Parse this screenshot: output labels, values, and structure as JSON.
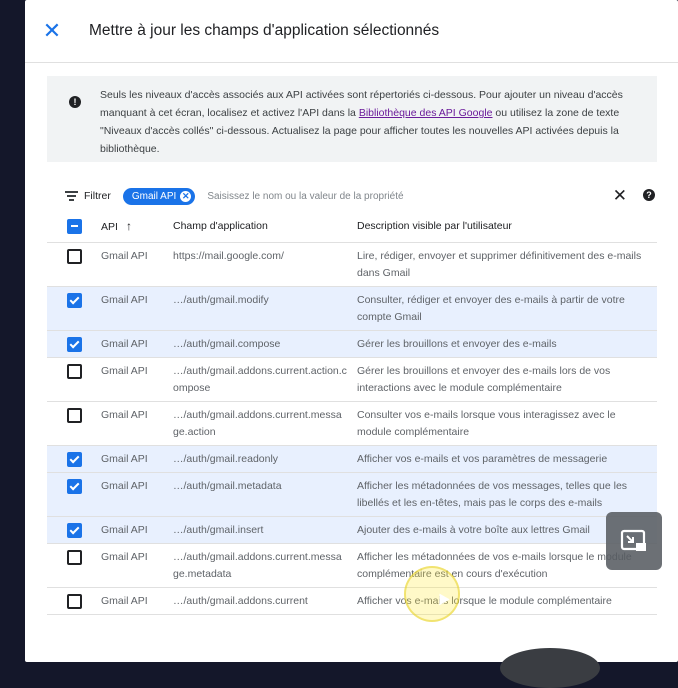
{
  "dialog": {
    "title": "Mettre à jour les champs d'application sélectionnés",
    "close_symbol": "✕"
  },
  "info": {
    "icon": "!",
    "text_before": "Seuls les niveaux d'accès associés aux API activées sont répertoriés ci-dessous. Pour ajouter un niveau d'accès manquant à cet écran, localisez et activez l'API dans la ",
    "link": "Bibliothèque des API Google",
    "text_after": " ou utilisez la zone de texte \"Niveaux d'accès collés\" ci-dessous. Actualisez la page pour afficher toutes les nouvelles API activées depuis la bibliothèque."
  },
  "filter": {
    "label": "Filtrer",
    "chip": "Gmail API",
    "chip_close": "✕",
    "placeholder": "Saisissez le nom ou la valeur de la propriété",
    "clear_symbol": "✕",
    "help_symbol": "?"
  },
  "table": {
    "columns": {
      "api": "API",
      "sort_arrow": "↑",
      "scope": "Champ d'application",
      "description": "Description visible par l'utilisateur"
    },
    "header_checkbox": "partial",
    "rows": [
      {
        "checked": false,
        "api": "Gmail API",
        "scope": "https://mail.google.com/",
        "description": "Lire, rédiger, envoyer et supprimer définitivement des e-mails dans Gmail"
      },
      {
        "checked": true,
        "api": "Gmail API",
        "scope": "…/auth/gmail.modify",
        "description": "Consulter, rédiger et envoyer des e-mails à partir de votre compte Gmail"
      },
      {
        "checked": true,
        "api": "Gmail API",
        "scope": "…/auth/gmail.compose",
        "description": "Gérer les brouillons et envoyer des e-mails"
      },
      {
        "checked": false,
        "api": "Gmail API",
        "scope": "…/auth/gmail.addons.current.action.compose",
        "description": "Gérer les brouillons et envoyer des e-mails lors de vos interactions avec le module complémentaire"
      },
      {
        "checked": false,
        "api": "Gmail API",
        "scope": "…/auth/gmail.addons.current.message.action",
        "description": "Consulter vos e-mails lorsque vous interagissez avec le module complémentaire"
      },
      {
        "checked": true,
        "api": "Gmail API",
        "scope": "…/auth/gmail.readonly",
        "description": "Afficher vos e-mails et vos paramètres de messagerie"
      },
      {
        "checked": true,
        "api": "Gmail API",
        "scope": "…/auth/gmail.metadata",
        "description": "Afficher les métadonnées de vos messages, telles que les libellés et les en-têtes, mais pas le corps des e-mails"
      },
      {
        "checked": true,
        "api": "Gmail API",
        "scope": "…/auth/gmail.insert",
        "description": "Ajouter des e-mails à votre boîte aux lettres Gmail"
      },
      {
        "checked": false,
        "api": "Gmail API",
        "scope": "…/auth/gmail.addons.current.message.metadata",
        "description": "Afficher les métadonnées de vos e-mails lorsque le module complémentaire est en cours d'exécution"
      },
      {
        "checked": false,
        "api": "Gmail API",
        "scope": "…/auth/gmail.addons.current",
        "description": "Afficher vos e-mails lorsque le module complémentaire"
      }
    ]
  },
  "overlay": {
    "pip_icon": "picture-in-picture-icon"
  }
}
